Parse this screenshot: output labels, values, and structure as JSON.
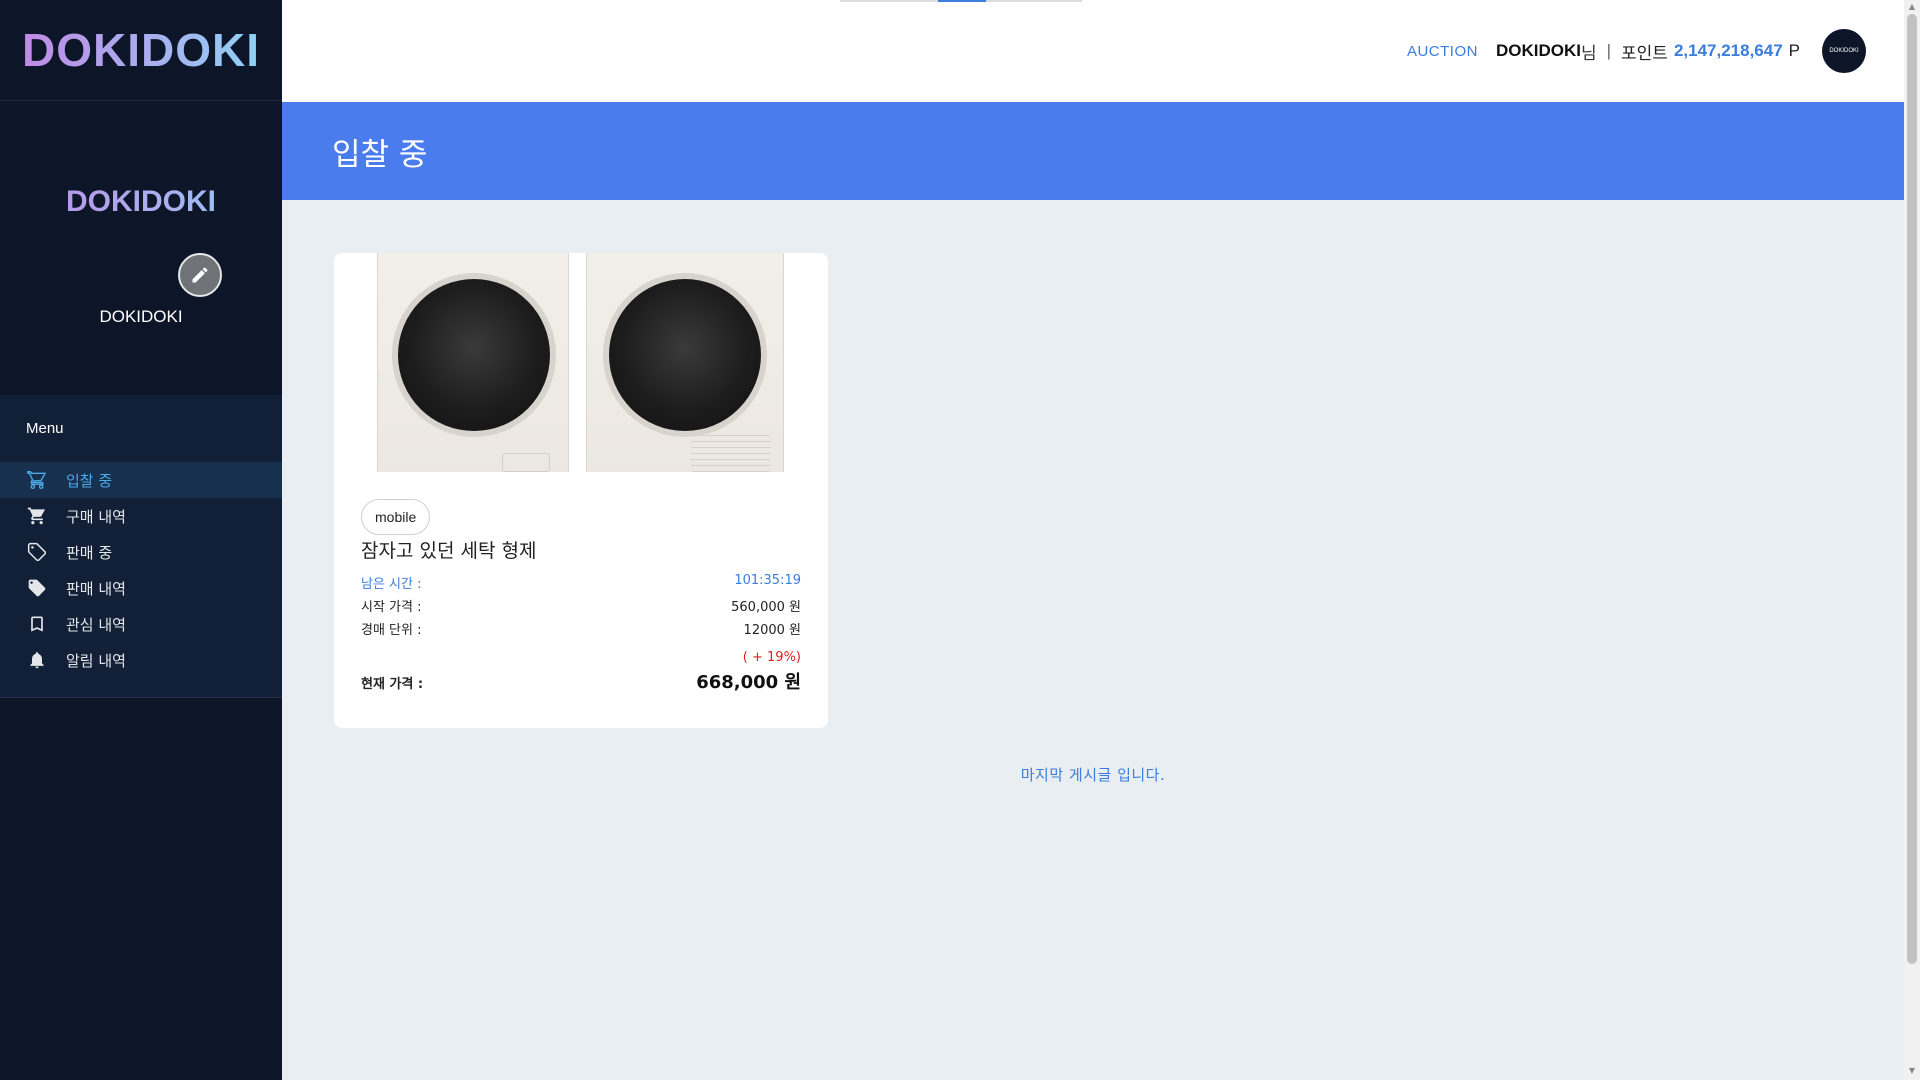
{
  "sidebar": {
    "brand": "DOKIDOKI",
    "profile_logo": "DOKIDOKI",
    "profile_name": "DOKIDOKI",
    "menu_title": "Menu",
    "items": [
      {
        "label": "입찰 중",
        "icon": "cart-icon",
        "active": true
      },
      {
        "label": "구매 내역",
        "icon": "cart-icon",
        "active": false
      },
      {
        "label": "판매 중",
        "icon": "tag-outline-icon",
        "active": false
      },
      {
        "label": "판매 내역",
        "icon": "tag-filled-icon",
        "active": false
      },
      {
        "label": "관심 내역",
        "icon": "bookmark-icon",
        "active": false
      },
      {
        "label": "알림 내역",
        "icon": "bell-icon",
        "active": false
      }
    ]
  },
  "header": {
    "auction_link": "AUCTION",
    "user_name": "DOKIDOKI",
    "user_suffix": "님",
    "separator": "|",
    "point_label": "포인트",
    "point_value": "2,147,218,647",
    "point_unit": "P",
    "avatar_text": "DOKIDOKI"
  },
  "banner": {
    "title": "입찰 중"
  },
  "card": {
    "category": "mobile",
    "title": "잠자고 있던 세탁 형제",
    "remaining_label": "남은 시간 :",
    "remaining_value": "101:35:19",
    "start_label": "시작 가격 :",
    "start_value": "560,000 원",
    "unit_label": "경매 단위 :",
    "unit_value": "12000 원",
    "rise": "( + 19%)",
    "current_label": "현재 가격 :",
    "current_value": "668,000 원"
  },
  "end_message": "마지막 게시글 입니다.",
  "colors": {
    "sidebar_bg": "#0d1628",
    "accent": "#3b7ddd",
    "banner_bg": "#4a7cee",
    "rise_red": "#e02020"
  }
}
